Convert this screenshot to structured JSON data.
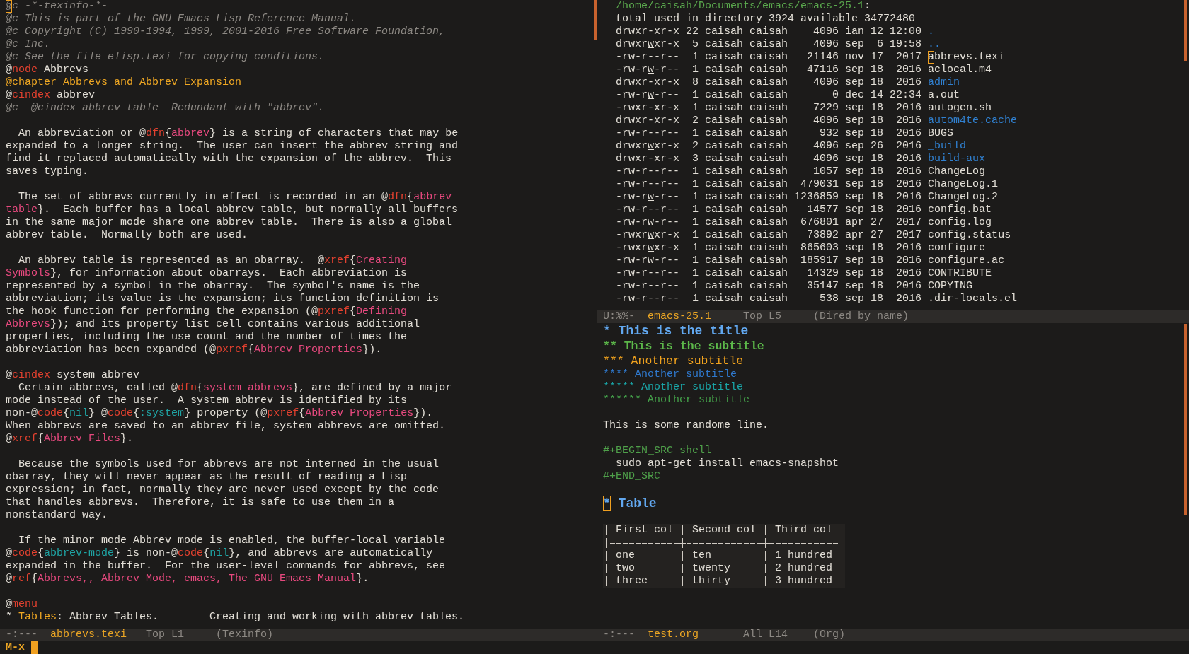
{
  "left_window": {
    "paragraphs": [
      [
        {
          "cursor": true,
          "segments": [
            {
              "kind": "comment",
              "text": "@c -*-texinfo-*-"
            }
          ]
        },
        {
          "cursor": false,
          "segments": [
            {
              "kind": "comment",
              "text": "@c This is part of the GNU Emacs Lisp Reference Manual."
            }
          ]
        },
        {
          "cursor": false,
          "segments": [
            {
              "kind": "comment",
              "text": "@c Copyright (C) 1990-1994, 1999, 2001-2016 Free Software Foundation,"
            }
          ]
        },
        {
          "cursor": false,
          "segments": [
            {
              "kind": "comment",
              "text": "@c Inc."
            }
          ]
        },
        {
          "cursor": false,
          "segments": [
            {
              "kind": "comment",
              "text": "@c See the file elisp.texi for copying conditions."
            }
          ]
        },
        {
          "cursor": false,
          "segments": [
            {
              "kind": "text",
              "text": "@"
            },
            {
              "kind": "command",
              "text": "node"
            },
            {
              "kind": "text",
              "text": " Abbrevs"
            }
          ]
        },
        {
          "cursor": false,
          "segments": [
            {
              "kind": "heading",
              "text": "@chapter Abbrevs and Abbrev Expansion"
            }
          ]
        },
        {
          "cursor": false,
          "segments": [
            {
              "kind": "text",
              "text": "@"
            },
            {
              "kind": "command",
              "text": "cindex"
            },
            {
              "kind": "text",
              "text": " abbrev"
            }
          ]
        },
        {
          "cursor": false,
          "segments": [
            {
              "kind": "comment",
              "text": "@c  @cindex abbrev table  Redundant with \"abbrev\"."
            }
          ]
        }
      ],
      [
        {
          "cursor": false,
          "segments": [
            {
              "kind": "text",
              "text": "  An abbreviation or @"
            },
            {
              "kind": "command",
              "text": "dfn"
            },
            {
              "kind": "text",
              "text": "{"
            },
            {
              "kind": "reference",
              "text": "abbrev"
            },
            {
              "kind": "text",
              "text": "} is a string of characters that may be"
            }
          ]
        },
        {
          "cursor": false,
          "segments": [
            {
              "kind": "text",
              "text": "expanded to a longer string.  The user can insert the abbrev string and"
            }
          ]
        },
        {
          "cursor": false,
          "segments": [
            {
              "kind": "text",
              "text": "find it replaced automatically with the expansion of the abbrev.  This"
            }
          ]
        },
        {
          "cursor": false,
          "segments": [
            {
              "kind": "text",
              "text": "saves typing."
            }
          ]
        }
      ],
      [
        {
          "cursor": false,
          "segments": [
            {
              "kind": "text",
              "text": "  The set of abbrevs currently in effect is recorded in an @"
            },
            {
              "kind": "command",
              "text": "dfn"
            },
            {
              "kind": "text",
              "text": "{"
            },
            {
              "kind": "reference",
              "text": "abbrev"
            }
          ]
        },
        {
          "cursor": false,
          "segments": [
            {
              "kind": "reference",
              "text": "table"
            },
            {
              "kind": "text",
              "text": "}.  Each buffer has a local abbrev table, but normally all buffers"
            }
          ]
        },
        {
          "cursor": false,
          "segments": [
            {
              "kind": "text",
              "text": "in the same major mode share one abbrev table.  There is also a global"
            }
          ]
        },
        {
          "cursor": false,
          "segments": [
            {
              "kind": "text",
              "text": "abbrev table.  Normally both are used."
            }
          ]
        }
      ],
      [
        {
          "cursor": false,
          "segments": [
            {
              "kind": "text",
              "text": "  An abbrev table is represented as an obarray.  @"
            },
            {
              "kind": "command",
              "text": "xref"
            },
            {
              "kind": "text",
              "text": "{"
            },
            {
              "kind": "reference",
              "text": "Creating"
            }
          ]
        },
        {
          "cursor": false,
          "segments": [
            {
              "kind": "reference",
              "text": "Symbols"
            },
            {
              "kind": "text",
              "text": "}, for information about obarrays.  Each abbreviation is"
            }
          ]
        },
        {
          "cursor": false,
          "segments": [
            {
              "kind": "text",
              "text": "represented by a symbol in the obarray.  The symbol's name is the"
            }
          ]
        },
        {
          "cursor": false,
          "segments": [
            {
              "kind": "text",
              "text": "abbreviation; its value is the expansion; its function definition is"
            }
          ]
        },
        {
          "cursor": false,
          "segments": [
            {
              "kind": "text",
              "text": "the hook function for performing the expansion (@"
            },
            {
              "kind": "command",
              "text": "pxref"
            },
            {
              "kind": "text",
              "text": "{"
            },
            {
              "kind": "reference",
              "text": "Defining"
            }
          ]
        },
        {
          "cursor": false,
          "segments": [
            {
              "kind": "reference",
              "text": "Abbrevs"
            },
            {
              "kind": "text",
              "text": "}); and its property list cell contains various additional"
            }
          ]
        },
        {
          "cursor": false,
          "segments": [
            {
              "kind": "text",
              "text": "properties, including the use count and the number of times the"
            }
          ]
        },
        {
          "cursor": false,
          "segments": [
            {
              "kind": "text",
              "text": "abbreviation has been expanded (@"
            },
            {
              "kind": "command",
              "text": "pxref"
            },
            {
              "kind": "text",
              "text": "{"
            },
            {
              "kind": "reference",
              "text": "Abbrev Properties"
            },
            {
              "kind": "text",
              "text": "})."
            }
          ]
        }
      ],
      [
        {
          "cursor": false,
          "segments": [
            {
              "kind": "text",
              "text": "@"
            },
            {
              "kind": "command",
              "text": "cindex"
            },
            {
              "kind": "text",
              "text": " system abbrev"
            }
          ]
        },
        {
          "cursor": false,
          "segments": [
            {
              "kind": "text",
              "text": "  Certain abbrevs, called @"
            },
            {
              "kind": "command",
              "text": "dfn"
            },
            {
              "kind": "text",
              "text": "{"
            },
            {
              "kind": "reference",
              "text": "system abbrevs"
            },
            {
              "kind": "text",
              "text": "}, are defined by a major"
            }
          ]
        },
        {
          "cursor": false,
          "segments": [
            {
              "kind": "text",
              "text": "mode instead of the user.  A system abbrev is identified by its"
            }
          ]
        },
        {
          "cursor": false,
          "segments": [
            {
              "kind": "text",
              "text": "non-@"
            },
            {
              "kind": "command",
              "text": "code"
            },
            {
              "kind": "text",
              "text": "{"
            },
            {
              "kind": "code",
              "text": "nil"
            },
            {
              "kind": "text",
              "text": "} @"
            },
            {
              "kind": "command",
              "text": "code"
            },
            {
              "kind": "text",
              "text": "{"
            },
            {
              "kind": "code",
              "text": ":system"
            },
            {
              "kind": "text",
              "text": "} property (@"
            },
            {
              "kind": "command",
              "text": "pxref"
            },
            {
              "kind": "text",
              "text": "{"
            },
            {
              "kind": "reference",
              "text": "Abbrev Properties"
            },
            {
              "kind": "text",
              "text": "})."
            }
          ]
        },
        {
          "cursor": false,
          "segments": [
            {
              "kind": "text",
              "text": "When abbrevs are saved to an abbrev file, system abbrevs are omitted."
            }
          ]
        },
        {
          "cursor": false,
          "segments": [
            {
              "kind": "text",
              "text": "@"
            },
            {
              "kind": "command",
              "text": "xref"
            },
            {
              "kind": "text",
              "text": "{"
            },
            {
              "kind": "reference",
              "text": "Abbrev Files"
            },
            {
              "kind": "text",
              "text": "}."
            }
          ]
        }
      ],
      [
        {
          "cursor": false,
          "segments": [
            {
              "kind": "text",
              "text": "  Because the symbols used for abbrevs are not interned in the usual"
            }
          ]
        },
        {
          "cursor": false,
          "segments": [
            {
              "kind": "text",
              "text": "obarray, they will never appear as the result of reading a Lisp"
            }
          ]
        },
        {
          "cursor": false,
          "segments": [
            {
              "kind": "text",
              "text": "expression; in fact, normally they are never used except by the code"
            }
          ]
        },
        {
          "cursor": false,
          "segments": [
            {
              "kind": "text",
              "text": "that handles abbrevs.  Therefore, it is safe to use them in a"
            }
          ]
        },
        {
          "cursor": false,
          "segments": [
            {
              "kind": "text",
              "text": "nonstandard way."
            }
          ]
        }
      ],
      [
        {
          "cursor": false,
          "segments": [
            {
              "kind": "text",
              "text": "  If the minor mode Abbrev mode is enabled, the buffer-local variable"
            }
          ]
        },
        {
          "cursor": false,
          "segments": [
            {
              "kind": "text",
              "text": "@"
            },
            {
              "kind": "command",
              "text": "code"
            },
            {
              "kind": "text",
              "text": "{"
            },
            {
              "kind": "code",
              "text": "abbrev-mode"
            },
            {
              "kind": "text",
              "text": "} is non-@"
            },
            {
              "kind": "command",
              "text": "code"
            },
            {
              "kind": "text",
              "text": "{"
            },
            {
              "kind": "code",
              "text": "nil"
            },
            {
              "kind": "text",
              "text": "}, and abbrevs are automatically"
            }
          ]
        },
        {
          "cursor": false,
          "segments": [
            {
              "kind": "text",
              "text": "expanded in the buffer.  For the user-level commands for abbrevs, see"
            }
          ]
        },
        {
          "cursor": false,
          "segments": [
            {
              "kind": "text",
              "text": "@"
            },
            {
              "kind": "command",
              "text": "ref"
            },
            {
              "kind": "text",
              "text": "{"
            },
            {
              "kind": "reference",
              "text": "Abbrevs,, Abbrev Mode, emacs, The GNU Emacs Manual"
            },
            {
              "kind": "text",
              "text": "}."
            }
          ]
        }
      ],
      [
        {
          "cursor": false,
          "segments": [
            {
              "kind": "text",
              "text": "@"
            },
            {
              "kind": "command",
              "text": "menu"
            }
          ]
        },
        {
          "cursor": false,
          "segments": [
            {
              "kind": "text",
              "text": "* "
            },
            {
              "kind": "heading",
              "text": "Tables"
            },
            {
              "kind": "text",
              "text": ": Abbrev Tables.        Creating and working with abbrev tables."
            }
          ]
        }
      ]
    ],
    "mode_line": {
      "state": "-:---",
      "buffer": "abbrevs.texi",
      "position": "Top L1",
      "mode": "(Texinfo)"
    }
  },
  "right_top_window": {
    "dired": {
      "header": {
        "path": "/home/caisah/Documents/emacs/emacs-25.1",
        "punctuation": ":"
      },
      "summary": "total used in directory 3924 available 34772480",
      "files": [
        {
          "perms": "drwxr-xr-x",
          "links": "22",
          "owner": "caisah",
          "group": "caisah",
          "size": "4096",
          "date": "ian 12 12:00",
          "name": ".",
          "directory": true,
          "group_write_underlined": false,
          "cursor": false
        },
        {
          "perms": "drwxrwxr-x",
          "links": "5",
          "owner": "caisah",
          "group": "caisah",
          "size": "4096",
          "date": "sep  6 19:58",
          "name": "..",
          "directory": true,
          "group_write_underlined": true,
          "cursor": false
        },
        {
          "perms": "-rw-r--r--",
          "links": "1",
          "owner": "caisah",
          "group": "caisah",
          "size": "21146",
          "date": "nov 17  2017",
          "name": "abbrevs.texi",
          "directory": false,
          "group_write_underlined": false,
          "cursor": true
        },
        {
          "perms": "-rw-rw-r--",
          "links": "1",
          "owner": "caisah",
          "group": "caisah",
          "size": "47116",
          "date": "sep 18  2016",
          "name": "aclocal.m4",
          "directory": false,
          "group_write_underlined": true,
          "cursor": false
        },
        {
          "perms": "drwxr-xr-x",
          "links": "8",
          "owner": "caisah",
          "group": "caisah",
          "size": "4096",
          "date": "sep 18  2016",
          "name": "admin",
          "directory": true,
          "group_write_underlined": false,
          "cursor": false
        },
        {
          "perms": "-rw-rw-r--",
          "links": "1",
          "owner": "caisah",
          "group": "caisah",
          "size": "0",
          "date": "dec 14 22:34",
          "name": "a.out",
          "directory": false,
          "group_write_underlined": true,
          "cursor": false
        },
        {
          "perms": "-rwxr-xr-x",
          "links": "1",
          "owner": "caisah",
          "group": "caisah",
          "size": "7229",
          "date": "sep 18  2016",
          "name": "autogen.sh",
          "directory": false,
          "group_write_underlined": false,
          "cursor": false
        },
        {
          "perms": "drwxr-xr-x",
          "links": "2",
          "owner": "caisah",
          "group": "caisah",
          "size": "4096",
          "date": "sep 18  2016",
          "name": "autom4te.cache",
          "directory": true,
          "group_write_underlined": false,
          "cursor": false
        },
        {
          "perms": "-rw-r--r--",
          "links": "1",
          "owner": "caisah",
          "group": "caisah",
          "size": "932",
          "date": "sep 18  2016",
          "name": "BUGS",
          "directory": false,
          "group_write_underlined": false,
          "cursor": false
        },
        {
          "perms": "drwxrwxr-x",
          "links": "2",
          "owner": "caisah",
          "group": "caisah",
          "size": "4096",
          "date": "sep 26  2016",
          "name": "_build",
          "directory": true,
          "group_write_underlined": true,
          "cursor": false
        },
        {
          "perms": "drwxr-xr-x",
          "links": "3",
          "owner": "caisah",
          "group": "caisah",
          "size": "4096",
          "date": "sep 18  2016",
          "name": "build-aux",
          "directory": true,
          "group_write_underlined": false,
          "cursor": false
        },
        {
          "perms": "-rw-r--r--",
          "links": "1",
          "owner": "caisah",
          "group": "caisah",
          "size": "1057",
          "date": "sep 18  2016",
          "name": "ChangeLog",
          "directory": false,
          "group_write_underlined": false,
          "cursor": false
        },
        {
          "perms": "-rw-r--r--",
          "links": "1",
          "owner": "caisah",
          "group": "caisah",
          "size": "479031",
          "date": "sep 18  2016",
          "name": "ChangeLog.1",
          "directory": false,
          "group_write_underlined": false,
          "cursor": false
        },
        {
          "perms": "-rw-rw-r--",
          "links": "1",
          "owner": "caisah",
          "group": "caisah",
          "size": "1236859",
          "date": "sep 18  2016",
          "name": "ChangeLog.2",
          "directory": false,
          "group_write_underlined": true,
          "cursor": false
        },
        {
          "perms": "-rw-r--r--",
          "links": "1",
          "owner": "caisah",
          "group": "caisah",
          "size": "14577",
          "date": "sep 18  2016",
          "name": "config.bat",
          "directory": false,
          "group_write_underlined": false,
          "cursor": false
        },
        {
          "perms": "-rw-rw-r--",
          "links": "1",
          "owner": "caisah",
          "group": "caisah",
          "size": "676801",
          "date": "apr 27  2017",
          "name": "config.log",
          "directory": false,
          "group_write_underlined": true,
          "cursor": false
        },
        {
          "perms": "-rwxrwxr-x",
          "links": "1",
          "owner": "caisah",
          "group": "caisah",
          "size": "73892",
          "date": "apr 27  2017",
          "name": "config.status",
          "directory": false,
          "group_write_underlined": true,
          "cursor": false
        },
        {
          "perms": "-rwxrwxr-x",
          "links": "1",
          "owner": "caisah",
          "group": "caisah",
          "size": "865603",
          "date": "sep 18  2016",
          "name": "configure",
          "directory": false,
          "group_write_underlined": true,
          "cursor": false
        },
        {
          "perms": "-rw-rw-r--",
          "links": "1",
          "owner": "caisah",
          "group": "caisah",
          "size": "185917",
          "date": "sep 18  2016",
          "name": "configure.ac",
          "directory": false,
          "group_write_underlined": true,
          "cursor": false
        },
        {
          "perms": "-rw-r--r--",
          "links": "1",
          "owner": "caisah",
          "group": "caisah",
          "size": "14329",
          "date": "sep 18  2016",
          "name": "CONTRIBUTE",
          "directory": false,
          "group_write_underlined": false,
          "cursor": false
        },
        {
          "perms": "-rw-r--r--",
          "links": "1",
          "owner": "caisah",
          "group": "caisah",
          "size": "35147",
          "date": "sep 18  2016",
          "name": "COPYING",
          "directory": false,
          "group_write_underlined": false,
          "cursor": false
        },
        {
          "perms": "-rw-r--r--",
          "links": "1",
          "owner": "caisah",
          "group": "caisah",
          "size": "538",
          "date": "sep 18  2016",
          "name": ".dir-locals.el",
          "directory": false,
          "group_write_underlined": false,
          "cursor": false
        }
      ]
    },
    "mode_line": {
      "state": "U:%%-",
      "buffer": "emacs-25.1",
      "position": "Top L5",
      "mode": "(Dired by name)"
    }
  },
  "right_bottom_window": {
    "outline": [
      {
        "heading": "* This is the title",
        "cursor": false,
        "children": [
          {
            "heading": "** This is the subtitle",
            "cursor": false,
            "children": [
              {
                "heading": "*** Another subtitle",
                "cursor": false,
                "children": [
                  {
                    "heading": "**** Another subtitle",
                    "cursor": false,
                    "children": [
                      {
                        "heading": "***** Another subtitle",
                        "cursor": false,
                        "children": [
                          {
                            "heading": "****** Another subtitle",
                            "cursor": false,
                            "body": [
                              {
                                "kind": "paragraph",
                                "text": "This is some randome line."
                              },
                              {
                                "kind": "src_block",
                                "begin": "#+BEGIN_SRC shell",
                                "code": [
                                  "  sudo apt-get install emacs-snapshot"
                                ],
                                "end": "#+END_SRC"
                              }
                            ]
                          }
                        ]
                      }
                    ]
                  }
                ]
              }
            ]
          }
        ]
      },
      {
        "heading": "* Table",
        "cursor": true,
        "body": [
          {
            "kind": "table",
            "columns": [
              "First col",
              "Second col",
              "Third col"
            ],
            "rows": [
              [
                "one",
                "ten",
                "1 hundred"
              ],
              [
                "two",
                "twenty",
                "2 hundred"
              ],
              [
                "three",
                "thirty",
                "3 hundred"
              ]
            ]
          }
        ]
      }
    ],
    "mode_line": {
      "state": "-:---",
      "buffer": "test.org",
      "position": "All L14",
      "mode": "(Org)"
    }
  },
  "minibuffer": {
    "prompt": "M-x",
    "cursor": true
  }
}
